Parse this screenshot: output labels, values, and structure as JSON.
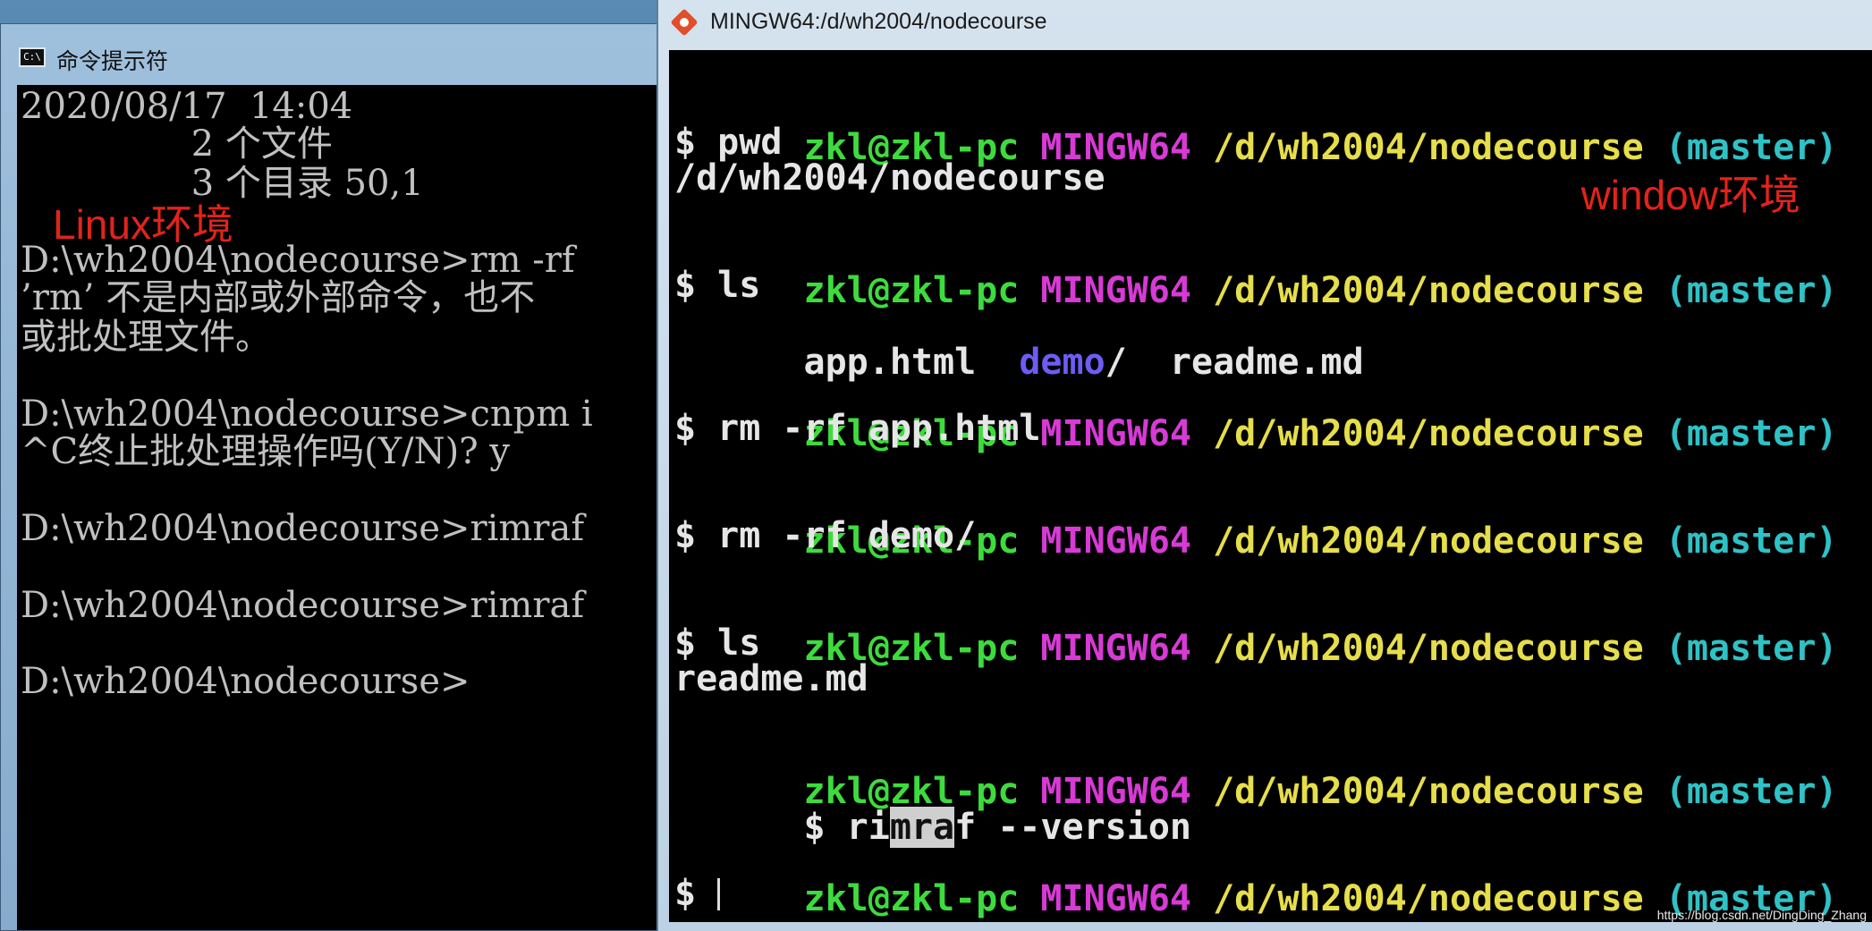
{
  "cmd_window": {
    "title": "命令提示符",
    "icon": "cmd-icon",
    "lines": [
      "2020/08/17  14:04",
      "               2 个文件",
      "               3 个目录 50,1",
      "",
      "D:\\wh2004\\nodecourse>rm -rf",
      "’rm’ 不是内部或外部命令，也不",
      "或批处理文件。",
      "",
      "D:\\wh2004\\nodecourse>cnpm i",
      "^C终止批处理操作吗(Y/N)? y",
      "",
      "D:\\wh2004\\nodecourse>rimraf",
      "",
      "D:\\wh2004\\nodecourse>rimraf",
      "",
      "D:\\wh2004\\nodecourse>"
    ],
    "annotation": "Linux环境"
  },
  "bash_window": {
    "title": "MINGW64:/d/wh2004/nodecourse",
    "icon": "git-icon",
    "prompt": {
      "user": "zkl@zkl-pc",
      "env": "MINGW64",
      "path": "/d/wh2004/nodecourse",
      "branch": "(master)"
    },
    "sessions": [
      {
        "command": "$ pwd",
        "output": "/d/wh2004/nodecourse"
      },
      {
        "command": "$ ls",
        "output_parts": {
          "file1": "app.html",
          "dir": "demo",
          "dir_slash": "/",
          "file2": "readme.md"
        }
      },
      {
        "command": "$ rm -rf app.html"
      },
      {
        "command": "$ rm -rf demo/"
      },
      {
        "command": "$ ls",
        "output": "readme.md"
      },
      {
        "command_parts": {
          "pre": "$ ri",
          "selected": "mra",
          "post": "f --version"
        }
      },
      {
        "command": "$ "
      }
    ],
    "annotation": "window环境"
  },
  "watermark": "https://blog.csdn.net/DingDing_Zhang",
  "colors": {
    "prompt_user": "#3ddc3d",
    "prompt_env": "#d83ad6",
    "prompt_path": "#e6de4a",
    "prompt_branch": "#2ec2c6",
    "directory": "#6e5cf5",
    "annotation": "#e2231a"
  }
}
